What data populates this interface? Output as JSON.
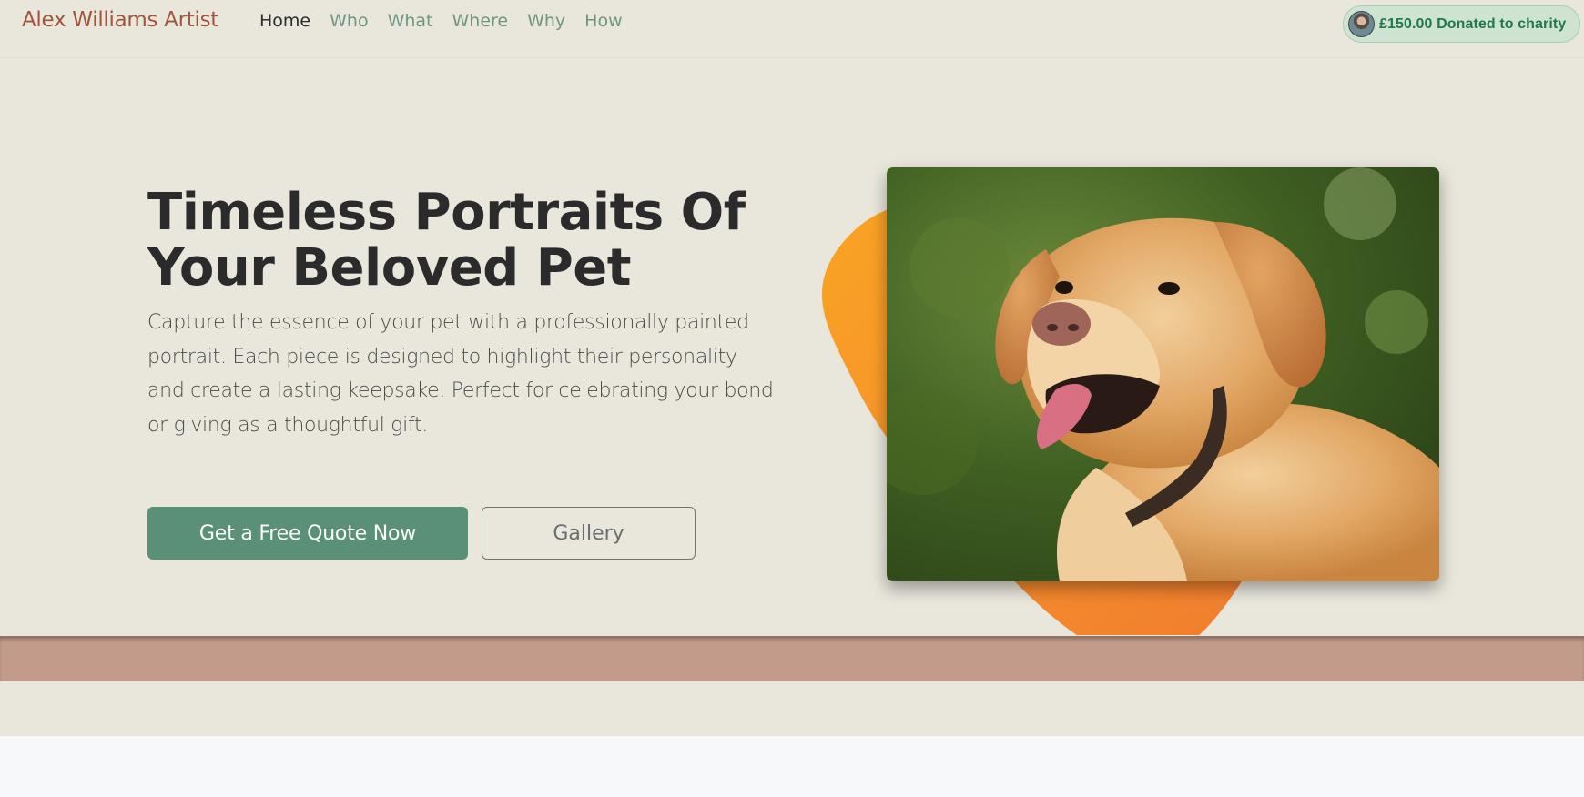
{
  "nav": {
    "brand": "Alex Williams Artist",
    "links": [
      {
        "label": "Home",
        "active": true
      },
      {
        "label": "Who",
        "active": false
      },
      {
        "label": "What",
        "active": false
      },
      {
        "label": "Where",
        "active": false
      },
      {
        "label": "Why",
        "active": false
      },
      {
        "label": "How",
        "active": false
      }
    ],
    "donation": {
      "text": "£150.00 Donated to charity"
    }
  },
  "hero": {
    "title_line1": "Timeless Portraits Of",
    "title_line2": "Your Beloved Pet",
    "description": "Capture the essence of your pet with a professionally painted portrait. Each piece is designed to highlight their personality and create a lasting keepsake. Perfect for celebrating your bond or giving as a thoughtful gift.",
    "cta_primary": "Get a Free Quote Now",
    "cta_secondary": "Gallery",
    "image_subject": "golden-labrador-dog-photo"
  },
  "colors": {
    "background": "#e9e7dc",
    "brand": "#a0553d",
    "nav_link": "#6f9683",
    "primary_button": "#5b9078",
    "accent_blob": "#f7902c",
    "band": "#c29b8a",
    "donation_text": "#1e7a4b"
  }
}
